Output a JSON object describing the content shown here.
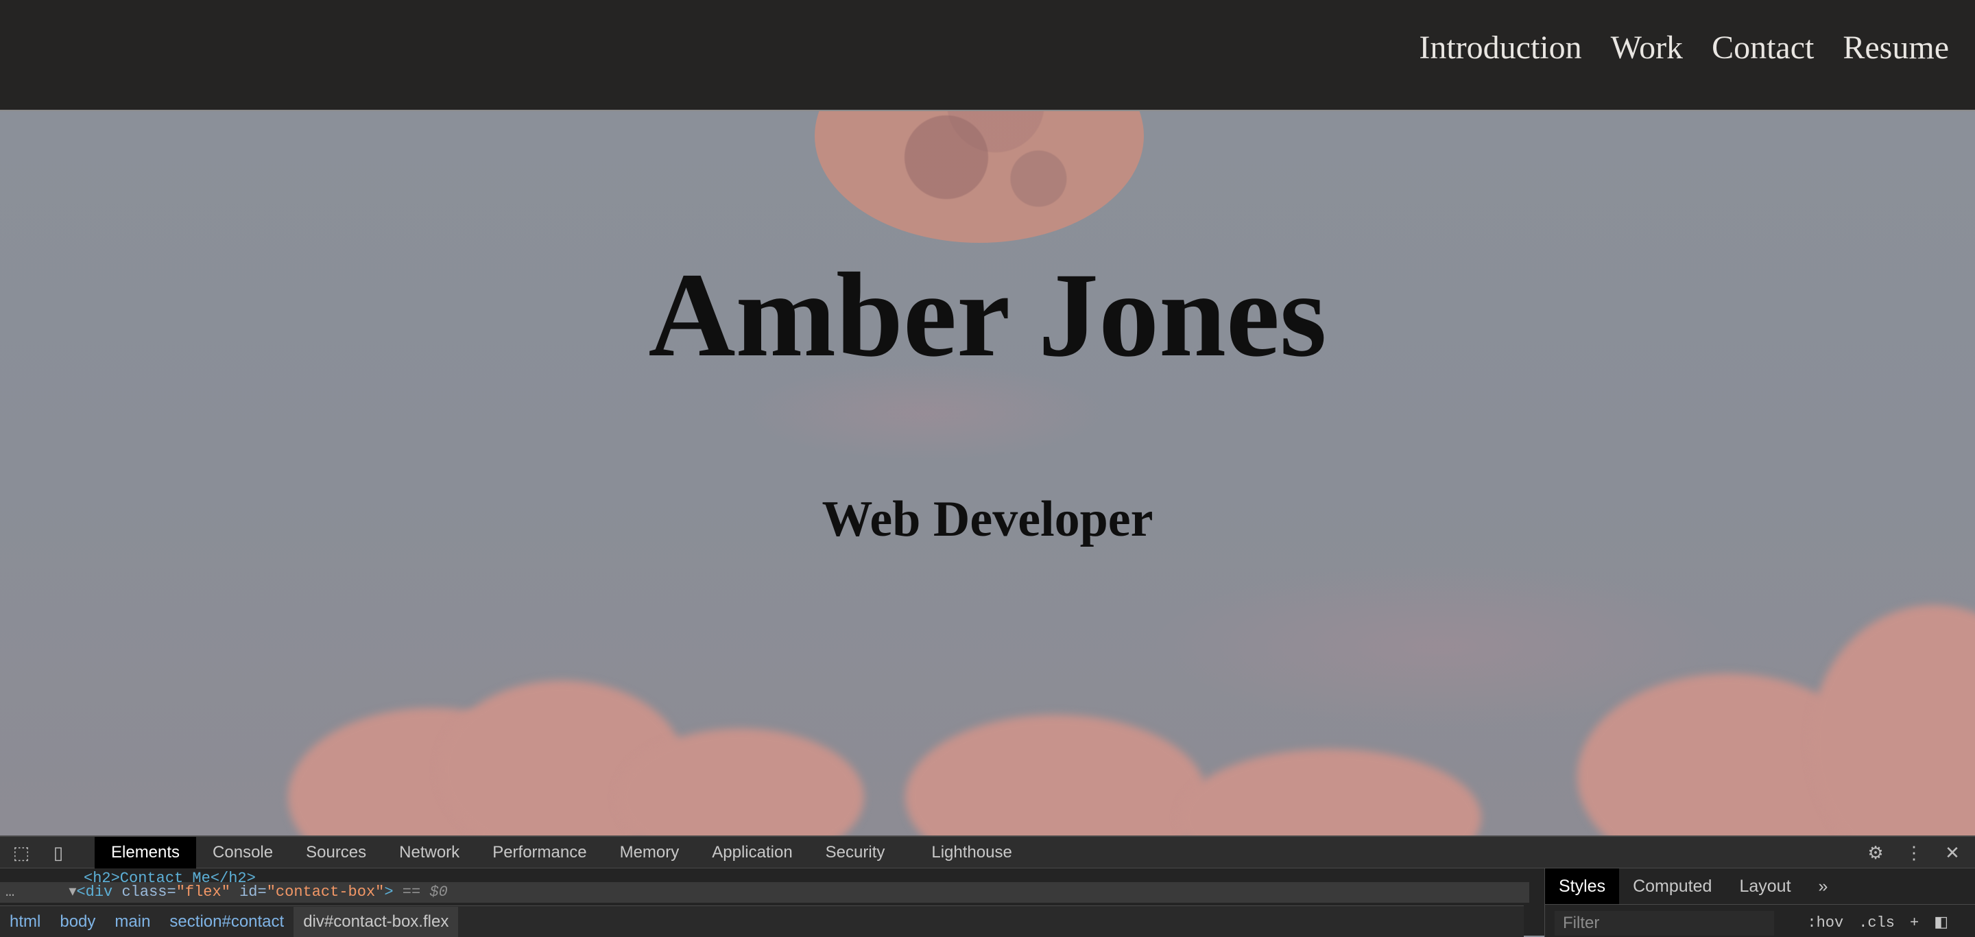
{
  "nav": {
    "items": [
      "Introduction",
      "Work",
      "Contact",
      "Resume"
    ]
  },
  "hero": {
    "name": "Amber Jones",
    "role": "Web Developer"
  },
  "devtools": {
    "tabs": [
      "Elements",
      "Console",
      "Sources",
      "Network",
      "Performance",
      "Memory",
      "Application",
      "Security",
      "Lighthouse"
    ],
    "active_tab": "Elements",
    "dom": {
      "line1": "<h2>Contact Me</h2>",
      "line2_tag_open": "<div",
      "line2_attr_class": "class=",
      "line2_val_class": "\"flex\"",
      "line2_attr_id": "id=",
      "line2_val_id": "\"contact-box\"",
      "line2_tag_close": ">",
      "line2_suffix": "== $0"
    },
    "breadcrumbs": [
      "html",
      "body",
      "main",
      "section#contact",
      "div#contact-box.flex"
    ],
    "side_tabs": [
      "Styles",
      "Computed",
      "Layout"
    ],
    "side_active": "Styles",
    "filter_placeholder": "Filter",
    "hov": ":hov",
    "cls": ".cls",
    "more_tabs": "»",
    "ellipsis": "…",
    "gear": "⚙",
    "kebab": "⋮",
    "close": "✕",
    "plus": "+"
  }
}
